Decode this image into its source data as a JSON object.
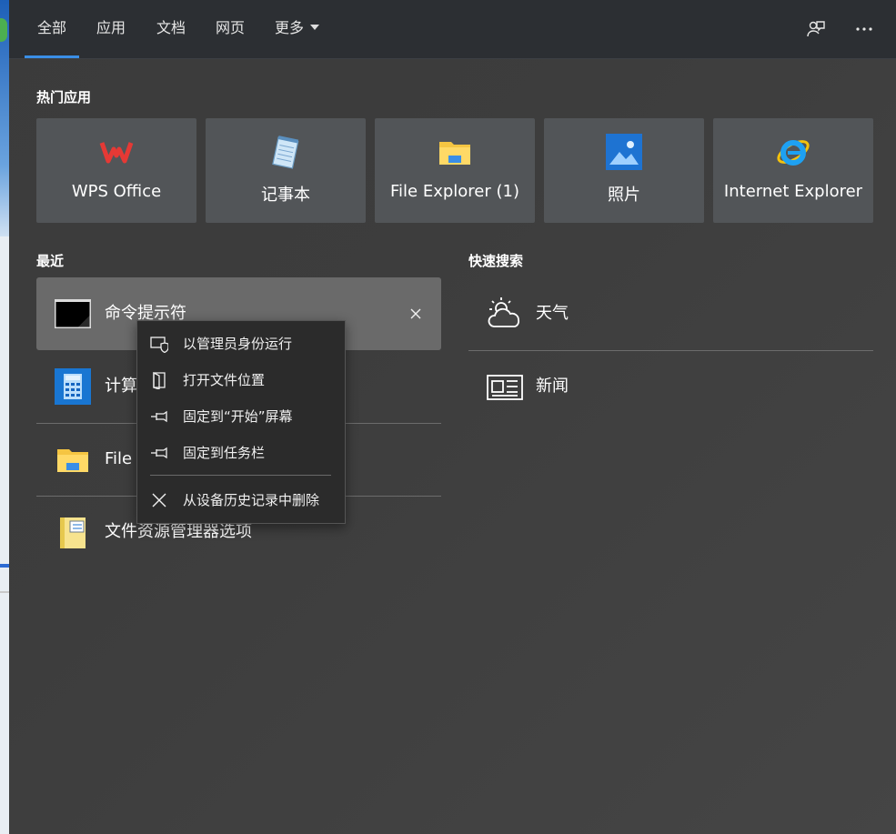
{
  "tabs": [
    {
      "label": "全部"
    },
    {
      "label": "应用"
    },
    {
      "label": "文档"
    },
    {
      "label": "网页"
    },
    {
      "label": "更多"
    }
  ],
  "sections": {
    "top_apps": "热门应用",
    "recent": "最近",
    "quick_search": "快速搜索"
  },
  "top_apps": [
    {
      "label": "WPS Office",
      "icon": "wps-office-icon"
    },
    {
      "label": "记事本",
      "icon": "notepad-icon"
    },
    {
      "label": "File Explorer (1)",
      "icon": "folder-icon"
    },
    {
      "label": "照片",
      "icon": "photos-icon"
    },
    {
      "label": "Internet Explorer",
      "icon": "internet-explorer-icon"
    }
  ],
  "recent": [
    {
      "label": "命令提示符",
      "icon": "command-prompt-icon"
    },
    {
      "label": "计算器",
      "icon": "calculator-icon"
    },
    {
      "label": "File Explorer",
      "icon": "folder-icon"
    },
    {
      "label": "文件资源管理器选项",
      "icon": "folder-options-icon"
    }
  ],
  "quick_search": [
    {
      "label": "天气",
      "icon": "weather-icon"
    },
    {
      "label": "新闻",
      "icon": "news-icon"
    }
  ],
  "context_menu": [
    {
      "label": "以管理员身份运行",
      "icon": "shield-icon"
    },
    {
      "label": "打开文件位置",
      "icon": "open-location-icon"
    },
    {
      "label": "固定到“开始”屏幕",
      "icon": "pin-icon"
    },
    {
      "label": "固定到任务栏",
      "icon": "pin-icon"
    },
    {
      "label": "从设备历史记录中删除",
      "icon": "close-icon"
    }
  ],
  "colors": {
    "accent": "#3a8ee6",
    "panel": "#3c3c3c",
    "tile": "#525558",
    "highlight": "#6a6a6a"
  }
}
